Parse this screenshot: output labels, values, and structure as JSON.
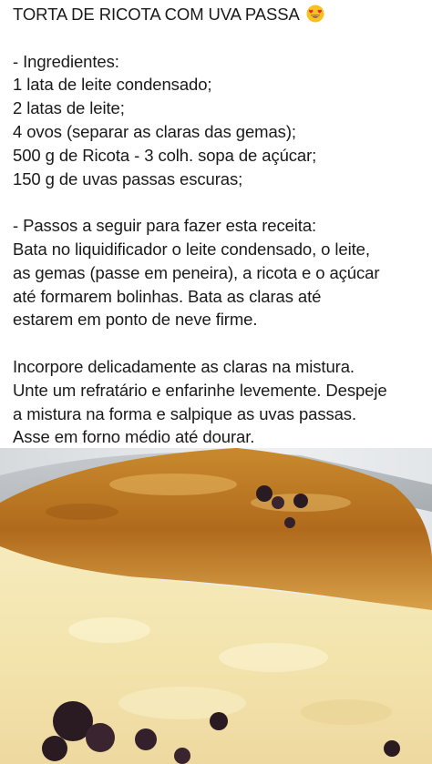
{
  "post": {
    "title": "TORTA DE RICOTA COM UVA PASSA",
    "title_emoji_icon": "heart-eyes-emoji-icon",
    "ingredients_heading": "- Ingredientes:",
    "ingredients": [
      "1 lata de leite condensado;",
      "2 latas de leite;",
      "4 ovos (separar as claras das gemas);",
      "500 g de Ricota - 3 colh. sopa de açúcar;",
      "150 g de uvas passas escuras;"
    ],
    "steps_heading": "- Passos a seguir para fazer esta receita:",
    "steps_paragraph_1": [
      "Bata no liquidificador o leite condensado, o leite,",
      "as gemas (passe em peneira), a ricota e o açúcar",
      "até formarem bolinhas. Bata as claras até",
      "estarem em ponto de neve firme."
    ],
    "steps_paragraph_2": [
      "Incorpore delicadamente as claras na mistura.",
      "Unte um refratário e enfarinhe levemente. Despeje",
      "a mistura na forma e salpique as uvas passas.",
      "Asse em forno médio até dourar."
    ]
  },
  "photo": {
    "subject": "ricotta-cake-slice-image",
    "colors": {
      "crust": "#b8741f",
      "filling": "#f3e6b4",
      "raisins": "#2a1a22",
      "plate": "#e9ecef"
    }
  }
}
